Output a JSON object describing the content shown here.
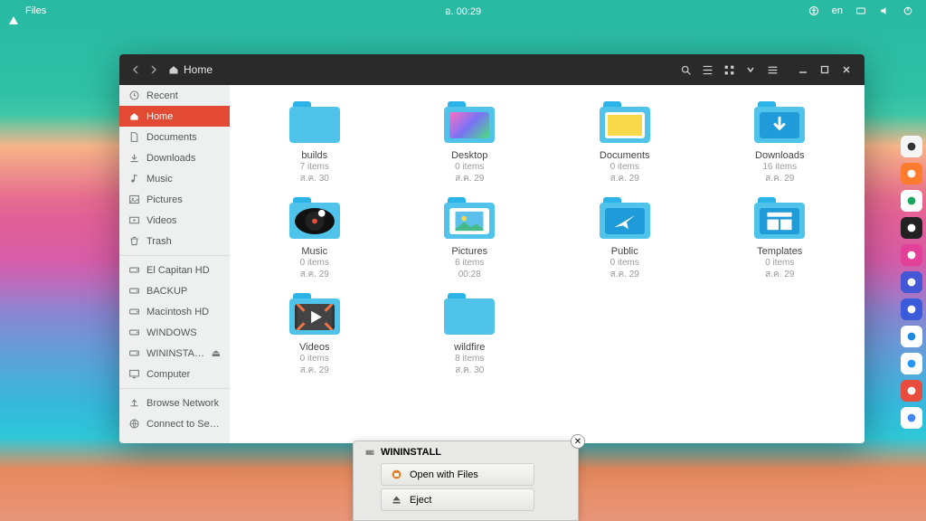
{
  "topbar": {
    "app_label": "Files",
    "clock": "อ. 00:29",
    "lang": "en"
  },
  "window": {
    "breadcrumb_icon": "home-icon",
    "breadcrumb": "Home",
    "sidebar": [
      {
        "icon": "clock",
        "label": "Recent"
      },
      {
        "icon": "home",
        "label": "Home",
        "active": true
      },
      {
        "icon": "doc",
        "label": "Documents"
      },
      {
        "icon": "download",
        "label": "Downloads"
      },
      {
        "icon": "music",
        "label": "Music"
      },
      {
        "icon": "image",
        "label": "Pictures"
      },
      {
        "icon": "video",
        "label": "Videos"
      },
      {
        "icon": "trash",
        "label": "Trash"
      },
      {
        "sep": true
      },
      {
        "icon": "drive",
        "label": "El Capitan HD"
      },
      {
        "icon": "drive",
        "label": "BACKUP"
      },
      {
        "icon": "drive",
        "label": "Macintosh HD"
      },
      {
        "icon": "drive",
        "label": "WINDOWS"
      },
      {
        "icon": "drive",
        "label": "WININSTALL",
        "eject": true
      },
      {
        "icon": "computer",
        "label": "Computer"
      },
      {
        "sep": true
      },
      {
        "icon": "network",
        "label": "Browse Network"
      },
      {
        "icon": "globe",
        "label": "Connect to Server"
      }
    ],
    "items": [
      {
        "name": "builds",
        "sub1": "7 items",
        "sub2": "ส.ค. 30",
        "variant": "plain"
      },
      {
        "name": "Desktop",
        "sub1": "0 items",
        "sub2": "ส.ค. 29",
        "variant": "desktop"
      },
      {
        "name": "Documents",
        "sub1": "0 items",
        "sub2": "ส.ค. 29",
        "variant": "documents"
      },
      {
        "name": "Downloads",
        "sub1": "16 items",
        "sub2": "ส.ค. 29",
        "variant": "downloads"
      },
      {
        "name": "Music",
        "sub1": "0 items",
        "sub2": "ส.ค. 29",
        "variant": "music"
      },
      {
        "name": "Pictures",
        "sub1": "6 items",
        "sub2": "00:28",
        "variant": "pictures"
      },
      {
        "name": "Public",
        "sub1": "0 items",
        "sub2": "ส.ค. 29",
        "variant": "public"
      },
      {
        "name": "Templates",
        "sub1": "0 items",
        "sub2": "ส.ค. 29",
        "variant": "templates"
      },
      {
        "name": "Videos",
        "sub1": "0 items",
        "sub2": "ส.ค. 29",
        "variant": "videos"
      },
      {
        "name": "wildfire",
        "sub1": "8 items",
        "sub2": "ส.ค. 30",
        "variant": "plain"
      }
    ]
  },
  "popup": {
    "title": "WININSTALL",
    "open_label": "Open with Files",
    "eject_label": "Eject"
  },
  "dock": [
    {
      "bg": "#f5f5f5",
      "fg": "#333"
    },
    {
      "bg": "#ff7b2e",
      "fg": "#fff"
    },
    {
      "bg": "#ffffff",
      "fg": "#1da462"
    },
    {
      "bg": "#222",
      "fg": "#fff"
    },
    {
      "bg": "#e3409a",
      "fg": "#fff"
    },
    {
      "bg": "#4458d6",
      "fg": "#fff"
    },
    {
      "bg": "#3b5bdb",
      "fg": "#fff"
    },
    {
      "bg": "#ffffff",
      "fg": "#1e88e5"
    },
    {
      "bg": "#ffffff",
      "fg": "#2196f3"
    },
    {
      "bg": "#e74c3c",
      "fg": "#fff"
    },
    {
      "bg": "#ffffff",
      "fg": "#4285f4"
    }
  ]
}
